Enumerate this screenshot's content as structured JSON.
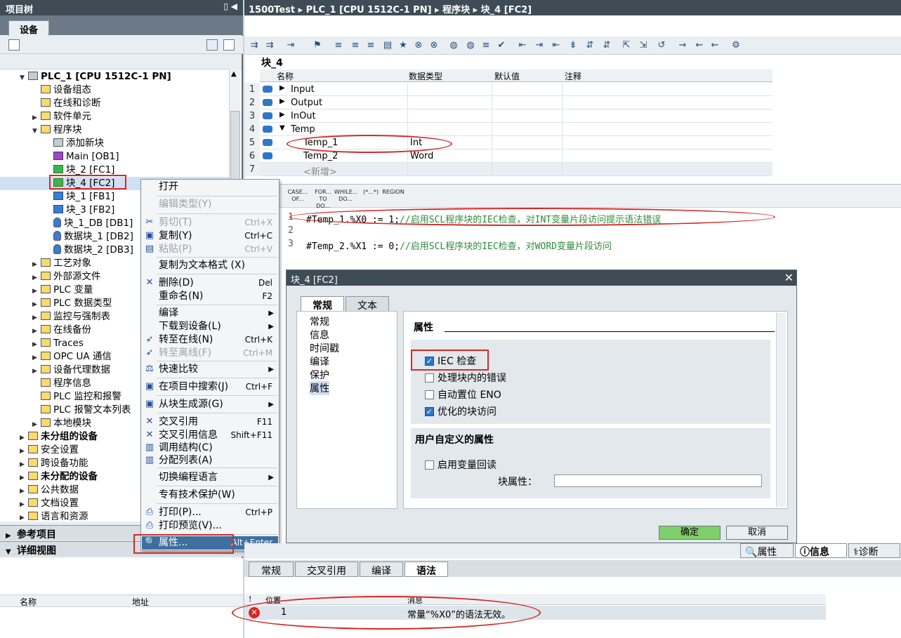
{
  "project_tree": {
    "title": "项目树",
    "device_tab": "设备",
    "items": [
      {
        "label": "PLC_1 [CPU 1512C-1 PN]",
        "indent": 0,
        "bold": true,
        "exp": "▼"
      },
      {
        "label": "设备组态",
        "indent": 1
      },
      {
        "label": "在线和诊断",
        "indent": 1
      },
      {
        "label": "软件单元",
        "indent": 1,
        "exp": "▶"
      },
      {
        "label": "程序块",
        "indent": 1,
        "exp": "▼"
      },
      {
        "label": "添加新块",
        "indent": 2
      },
      {
        "label": "Main [OB1]",
        "indent": 2
      },
      {
        "label": "块_2 [FC1]",
        "indent": 2
      },
      {
        "label": "块_4 [FC2]",
        "indent": 2
      },
      {
        "label": "块_1 [FB1]",
        "indent": 2
      },
      {
        "label": "块_3 [FB2]",
        "indent": 2
      },
      {
        "label": "块_1_DB [DB1]",
        "indent": 2
      },
      {
        "label": "数据块_1 [DB2]",
        "indent": 2
      },
      {
        "label": "数据块_2 [DB3]",
        "indent": 2
      },
      {
        "label": "工艺对象",
        "indent": 1,
        "exp": "▶"
      },
      {
        "label": "外部源文件",
        "indent": 1,
        "exp": "▶"
      },
      {
        "label": "PLC 变量",
        "indent": 1,
        "exp": "▶"
      },
      {
        "label": "PLC 数据类型",
        "indent": 1,
        "exp": "▶"
      },
      {
        "label": "监控与强制表",
        "indent": 1,
        "exp": "▶"
      },
      {
        "label": "在线备份",
        "indent": 1,
        "exp": "▶"
      },
      {
        "label": "Traces",
        "indent": 1,
        "exp": "▶"
      },
      {
        "label": "OPC UA 通信",
        "indent": 1,
        "exp": "▶"
      },
      {
        "label": "设备代理数据",
        "indent": 1,
        "exp": "▶"
      },
      {
        "label": "程序信息",
        "indent": 1
      },
      {
        "label": "PLC 监控和报警",
        "indent": 1
      },
      {
        "label": "PLC 报警文本列表",
        "indent": 1
      },
      {
        "label": "本地模块",
        "indent": 1,
        "exp": "▶"
      },
      {
        "label": "未分组的设备",
        "indent": 0,
        "bold": true,
        "exp": "▶"
      },
      {
        "label": "安全设置",
        "indent": 0,
        "exp": "▶"
      },
      {
        "label": "跨设备功能",
        "indent": 0,
        "exp": "▶"
      },
      {
        "label": "未分配的设备",
        "indent": 0,
        "bold": true,
        "exp": "▶"
      },
      {
        "label": "公共数据",
        "indent": 0,
        "exp": "▶"
      },
      {
        "label": "文档设置",
        "indent": 0,
        "exp": "▶"
      },
      {
        "label": "语言和资源",
        "indent": 0,
        "exp": "▶"
      }
    ],
    "ref_projects": "参考项目",
    "detail_view": "详细视图",
    "detail_cols": [
      "名称",
      "地址"
    ]
  },
  "breadcrumb": "1500Test  ▸  PLC_1 [CPU 1512C-1 PN]  ▸  程序块  ▸  块_4 [FC2]",
  "block": {
    "name": "块_4",
    "cols": [
      "名称",
      "数据类型",
      "默认值",
      "注释"
    ],
    "rows": [
      {
        "num": "1",
        "name": "Input",
        "type": "",
        "exp": "▶"
      },
      {
        "num": "2",
        "name": "Output",
        "type": "",
        "exp": "▶"
      },
      {
        "num": "3",
        "name": "InOut",
        "type": "",
        "exp": "▶"
      },
      {
        "num": "4",
        "name": "Temp",
        "type": "",
        "exp": "▼"
      },
      {
        "num": "5",
        "name": "Temp_1",
        "type": "Int",
        "exp": ""
      },
      {
        "num": "6",
        "name": "Temp_2",
        "type": "Word",
        "exp": ""
      },
      {
        "num": "7",
        "name": "<新增>",
        "type": "",
        "exp": ""
      }
    ]
  },
  "scl_buttons": [
    "CASE... OF...",
    "FOR... TO DO...",
    "WHILE... DO...",
    "(*...*)",
    "REGION"
  ],
  "code": {
    "lines": [
      "1",
      "2",
      "3"
    ],
    "line1_code": "#Temp_1.%X0 := 1;",
    "line1_comment": "//启用SCL程序块的IEC检查，对INT变量片段访问提示语法错误",
    "line3_code": "#Temp_2.%X1 := 0;",
    "line3_comment": "//启用SCL程序块的IEC检查，对WORD变量片段访问"
  },
  "context_menu": {
    "open": "打开",
    "edit_type": "编辑类型(Y)",
    "cut": "剪切(T)",
    "cut_sc": "Ctrl+X",
    "copy": "复制(Y)",
    "copy_sc": "Ctrl+C",
    "paste": "粘贴(P)",
    "paste_sc": "Ctrl+V",
    "copy_text": "复制为文本格式 (X)",
    "delete": "删除(D)",
    "delete_sc": "Del",
    "rename": "重命名(N)",
    "rename_sc": "F2",
    "compile": "编译",
    "download": "下载到设备(L)",
    "online": "转至在线(N)",
    "online_sc": "Ctrl+K",
    "offline": "转至离线(F)",
    "offline_sc": "Ctrl+M",
    "compare": "快速比较",
    "search": "在项目中搜索(J)",
    "search_sc": "Ctrl+F",
    "gen_source": "从块生成源(G)",
    "xref": "交叉引用",
    "xref_sc": "F11",
    "xref_info": "交叉引用信息",
    "xref_info_sc": "Shift+F11",
    "call_struct": "调用结构(C)",
    "assign_list": "分配列表(A)",
    "switch_lang": "切换编程语言",
    "know_how": "专有技术保护(W)",
    "print": "打印(P)...",
    "print_sc": "Ctrl+P",
    "print_preview": "打印预览(V)...",
    "properties": "属性...",
    "properties_sc": "Alt+Enter"
  },
  "dialog": {
    "title": "块_4 [FC2]",
    "tab_general": "常规",
    "tab_text": "文本",
    "nav": [
      "常规",
      "信息",
      "时间戳",
      "编译",
      "保护",
      "属性"
    ],
    "section_title": "属性",
    "iec_check": "IEC 检查",
    "handle_errors": "处理块内的错误",
    "auto_eno": "自动置位 ENO",
    "optimized": "优化的块访问",
    "user_attrs": "用户自定义的属性",
    "readback": "启用变量回读",
    "block_attr": "块属性：",
    "ok": "确定",
    "cancel": "取消"
  },
  "inspector": {
    "tabs": [
      "属性",
      "信息",
      "诊断"
    ],
    "subtabs": [
      "常规",
      "交叉引用",
      "编译",
      "语法"
    ],
    "cols": [
      "!",
      "位置",
      "消息"
    ],
    "row_pos": "1",
    "row_msg": "常量“%X0”的语法无效。"
  }
}
